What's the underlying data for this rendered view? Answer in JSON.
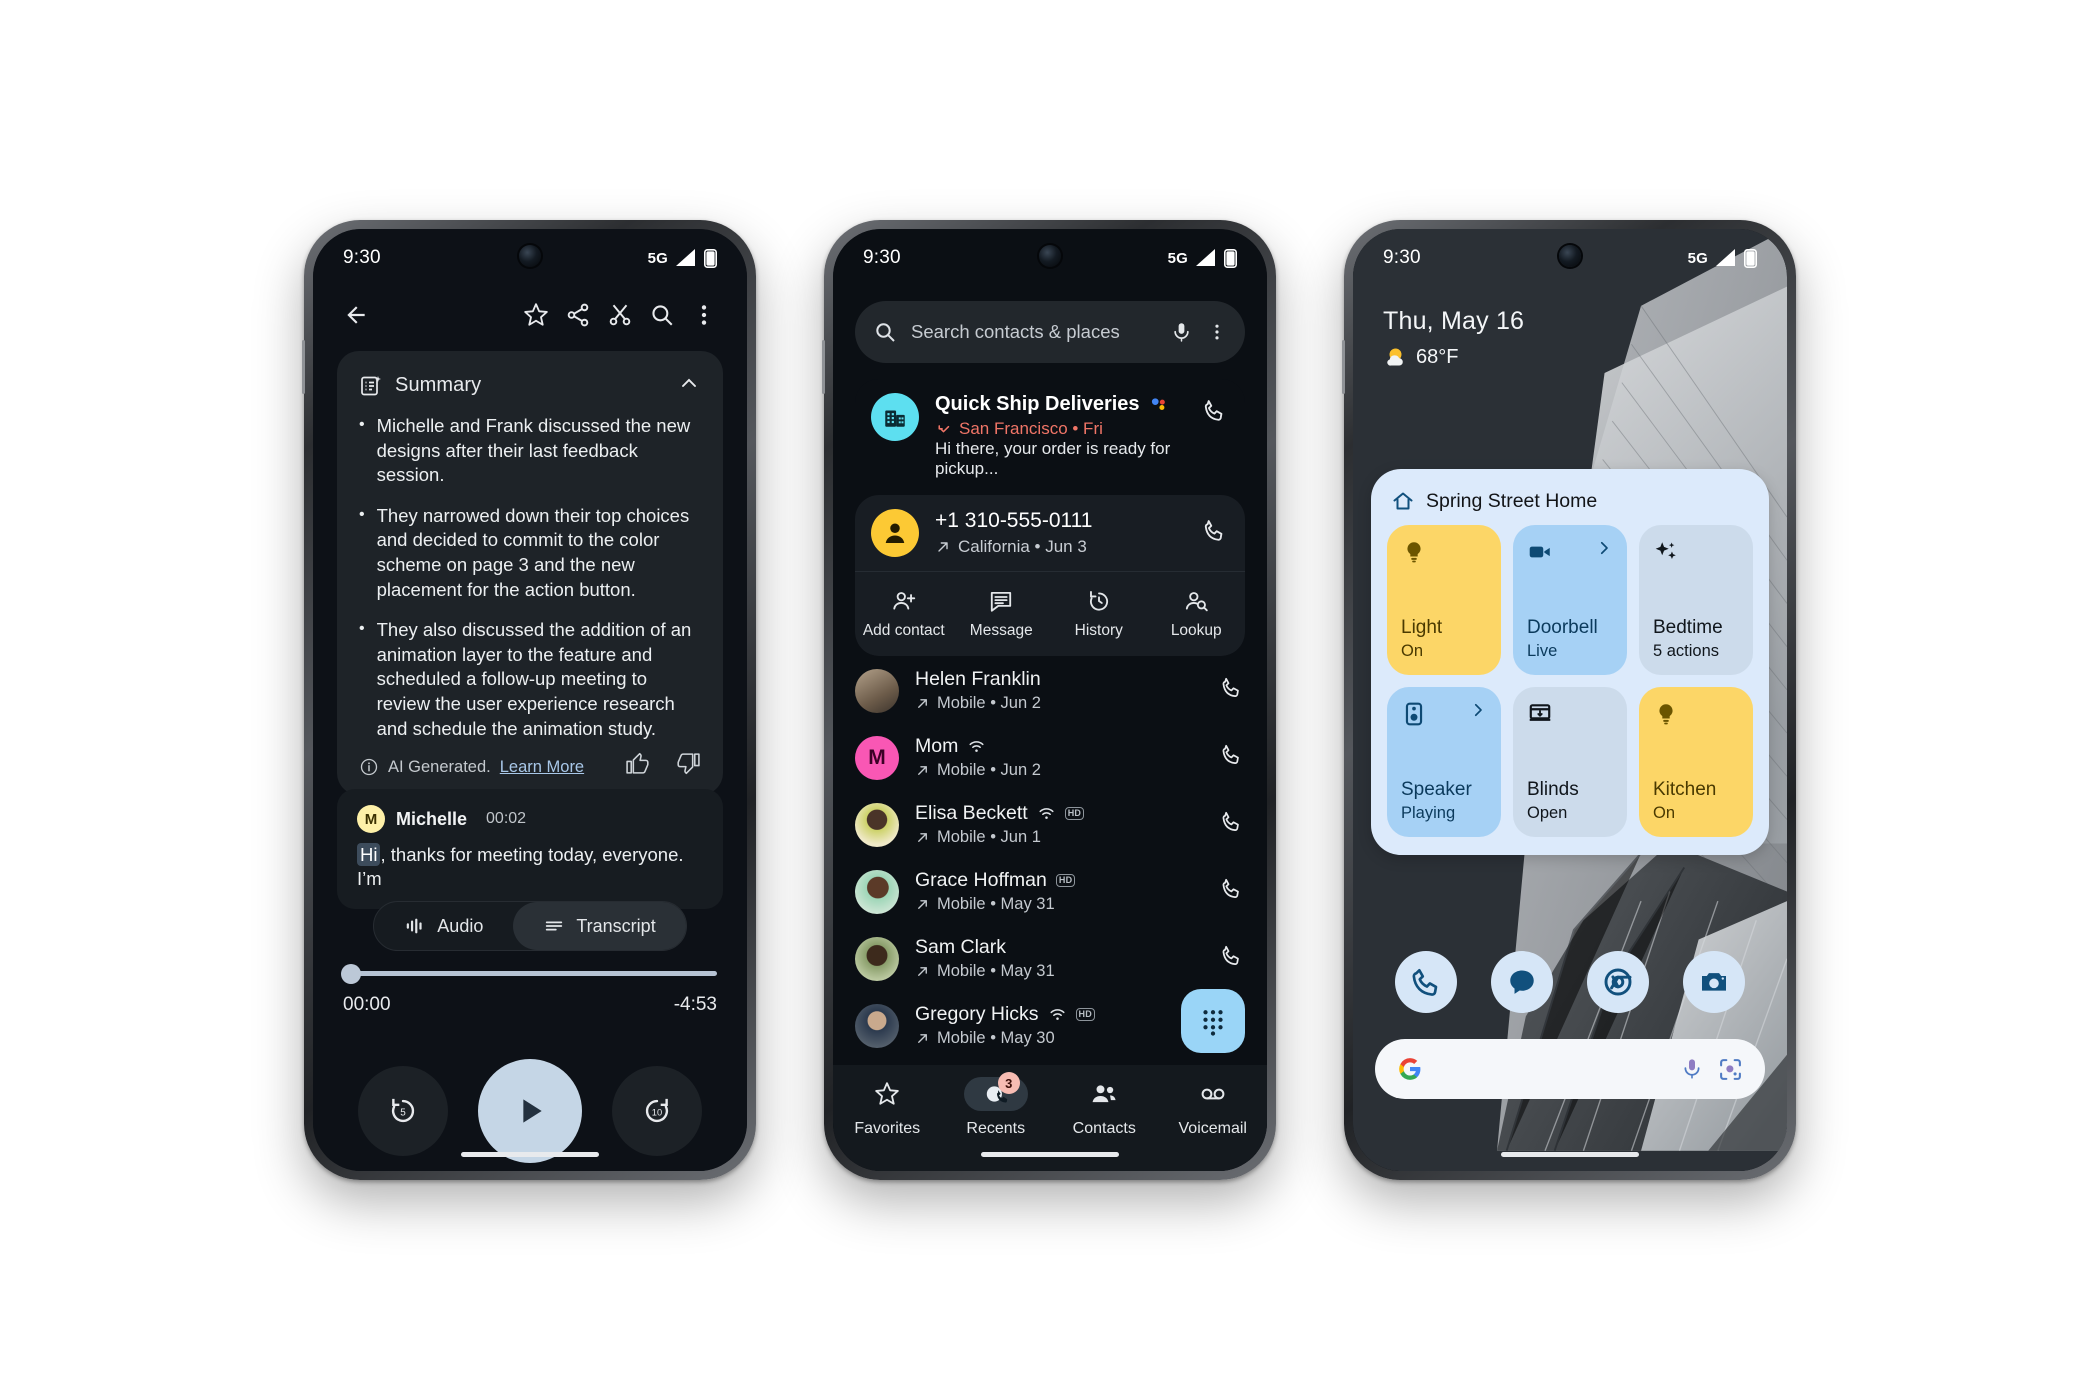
{
  "phone1": {
    "status": {
      "time": "9:30",
      "network": "5G"
    },
    "toolbar": {
      "back": "back-arrow",
      "star": "star",
      "share": "share",
      "cut": "cut",
      "search": "search",
      "more": "more"
    },
    "summary": {
      "title": "Summary",
      "bullets": [
        "Michelle and Frank discussed the new designs after their last feedback session.",
        "They narrowed down their top choices and decided to commit to the color scheme on page 3 and the new placement for the action button.",
        "They also discussed the addition of an animation layer to the feature and scheduled a follow-up meeting to review the user experience research and schedule the animation study."
      ],
      "ai_note": "AI Generated.",
      "ai_link": "Learn More"
    },
    "transcript": {
      "speaker": "Michelle",
      "timestamp": "00:02",
      "highlight": "Hi",
      "text": ", thanks for meeting today, everyone. I’m"
    },
    "tabs": {
      "audio": "Audio",
      "transcript": "Transcript",
      "active": "Transcript"
    },
    "player": {
      "elapsed": "00:00",
      "remaining": "-4:53",
      "progress_percent": 0,
      "rewind": "5",
      "forward": "10"
    }
  },
  "phone2": {
    "status": {
      "time": "9:30",
      "network": "5G"
    },
    "search": {
      "placeholder": "Search contacts & places"
    },
    "business_card": {
      "name": "Quick Ship Deliveries",
      "location": "San Francisco • Fri",
      "snippet": "Hi there, your order is ready for pickup..."
    },
    "number_card": {
      "number": "+1 310-555-0111",
      "detail": "California • Jun 3",
      "actions": [
        "Add contact",
        "Message",
        "History",
        "Lookup"
      ]
    },
    "contacts": [
      {
        "name": "Helen Franklin",
        "detail": "Mobile • Jun 2",
        "wifi": false,
        "hd": false,
        "avatar_type": "photo",
        "avatar_color": "#8d7a63"
      },
      {
        "name": "Mom",
        "detail": "Mobile • Jun 2",
        "wifi": true,
        "hd": false,
        "avatar_type": "mono",
        "avatar_color": "#f957b4",
        "initial": "M"
      },
      {
        "name": "Elisa Beckett",
        "detail": "Mobile • Jun 1",
        "wifi": true,
        "hd": true,
        "avatar_type": "photo",
        "avatar_color": "#c7b48a"
      },
      {
        "name": "Grace Hoffman",
        "detail": "Mobile • May 31",
        "wifi": false,
        "hd": true,
        "avatar_type": "photo",
        "avatar_color": "#7e9b85"
      },
      {
        "name": "Sam Clark",
        "detail": "Mobile • May 31",
        "wifi": false,
        "hd": false,
        "avatar_type": "photo",
        "avatar_color": "#6f7f62"
      },
      {
        "name": "Gregory Hicks",
        "detail": "Mobile • May 30",
        "wifi": true,
        "hd": true,
        "avatar_type": "photo",
        "avatar_color": "#5b6470"
      }
    ],
    "fab": "dialpad",
    "nav": [
      {
        "label": "Favorites",
        "icon": "star",
        "active": false,
        "badge": ""
      },
      {
        "label": "Recents",
        "icon": "recent-call",
        "active": true,
        "badge": "3"
      },
      {
        "label": "Contacts",
        "icon": "people",
        "active": false,
        "badge": ""
      },
      {
        "label": "Voicemail",
        "icon": "voicemail",
        "active": false,
        "badge": ""
      }
    ]
  },
  "phone3": {
    "status": {
      "time": "9:30",
      "network": "5G"
    },
    "glance": {
      "date": "Thu, May 16",
      "temperature": "68°F",
      "weather_icon": "sun-behind-cloud"
    },
    "home_widget": {
      "title": "Spring Street Home",
      "tiles": [
        {
          "name": "Light",
          "state": "On",
          "icon": "bulb-icon",
          "color": "yellow",
          "chevron": false
        },
        {
          "name": "Doorbell",
          "state": "Live",
          "icon": "videocam-icon",
          "color": "blue",
          "chevron": true
        },
        {
          "name": "Bedtime",
          "state": "5 actions",
          "icon": "sparkle-icon",
          "color": "grey",
          "chevron": false
        },
        {
          "name": "Speaker",
          "state": "Playing",
          "icon": "speaker-icon",
          "color": "blue",
          "chevron": true
        },
        {
          "name": "Blinds",
          "state": "Open",
          "icon": "blinds-icon",
          "color": "grey",
          "chevron": false
        },
        {
          "name": "Kitchen",
          "state": "On",
          "icon": "bulb-icon",
          "color": "yellow",
          "chevron": false
        }
      ]
    },
    "dock": [
      {
        "name": "phone-icon"
      },
      {
        "name": "messages-icon"
      },
      {
        "name": "chrome-icon"
      },
      {
        "name": "camera-icon"
      }
    ],
    "search": {
      "logo": "google-g",
      "mic": "mic-icon",
      "lens": "lens-icon"
    }
  },
  "colors": {
    "accent_blue": "#a6d1f5",
    "accent_yellow": "#fcd667",
    "surface_dark": "#1e2328",
    "badge_red": "#f07567"
  }
}
